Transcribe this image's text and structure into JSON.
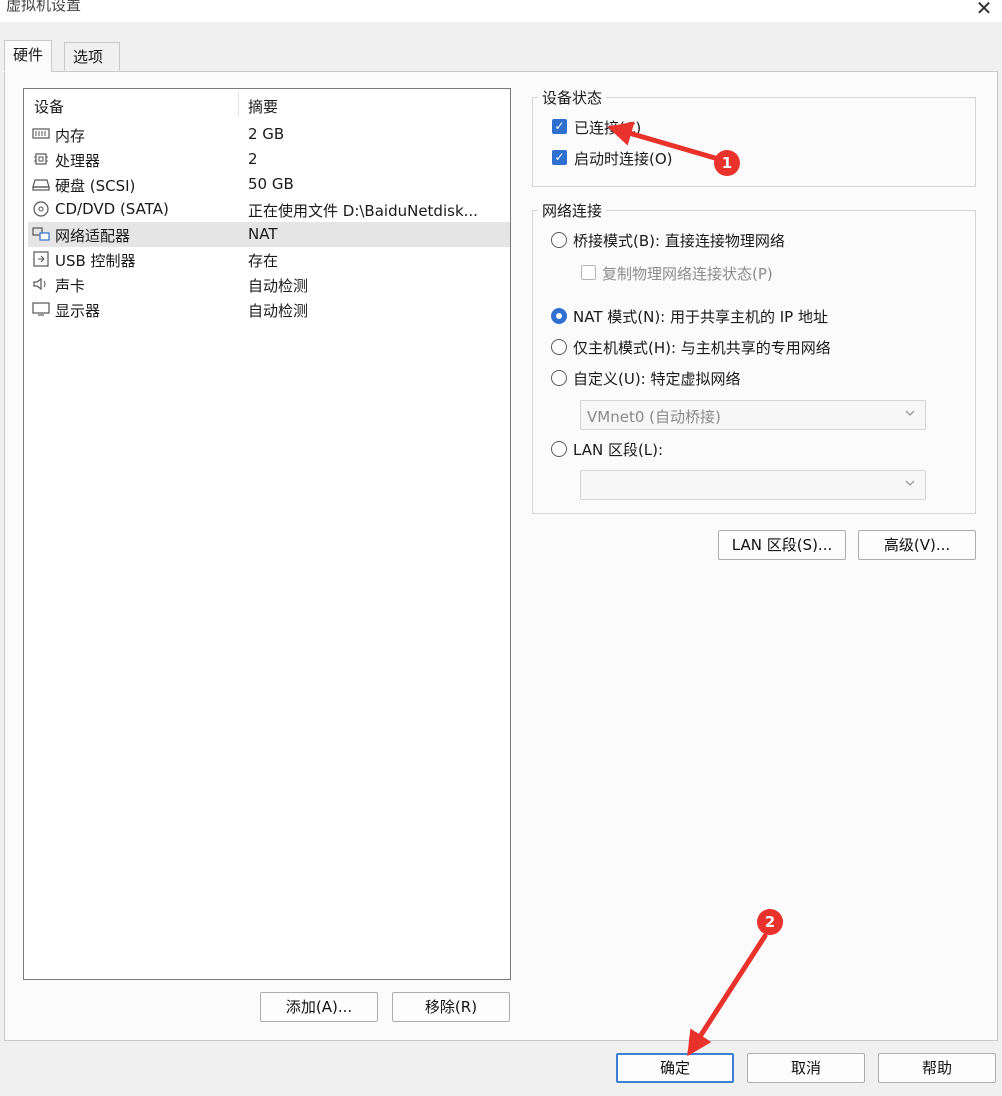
{
  "window": {
    "title": "虚拟机设置",
    "close_glyph": "✕"
  },
  "tabs": [
    {
      "label": "硬件",
      "active": true
    },
    {
      "label": "选项",
      "active": false
    }
  ],
  "device_list": {
    "columns": [
      "设备",
      "摘要"
    ],
    "rows": [
      {
        "icon": "memory-icon",
        "name": "内存",
        "summary": "2 GB"
      },
      {
        "icon": "processor-icon",
        "name": "处理器",
        "summary": "2"
      },
      {
        "icon": "hard-disk-icon",
        "name": "硬盘 (SCSI)",
        "summary": "50 GB"
      },
      {
        "icon": "cd-dvd-icon",
        "name": "CD/DVD (SATA)",
        "summary": "正在使用文件 D:\\BaiduNetdisk..."
      },
      {
        "icon": "network-adapter-icon",
        "name": "网络适配器",
        "summary": "NAT",
        "selected": true
      },
      {
        "icon": "usb-controller-icon",
        "name": "USB 控制器",
        "summary": "存在"
      },
      {
        "icon": "sound-card-icon",
        "name": "声卡",
        "summary": "自动检测"
      },
      {
        "icon": "display-icon",
        "name": "显示器",
        "summary": "自动检测"
      }
    ],
    "add_label": "添加(A)...",
    "remove_label": "移除(R)"
  },
  "device_status": {
    "title": "设备状态",
    "connected": {
      "label": "已连接(C)",
      "checked": true
    },
    "connect_on_power_on": {
      "label": "启动时连接(O)",
      "checked": true
    }
  },
  "network_connection": {
    "title": "网络连接",
    "bridged": {
      "label": "桥接模式(B): 直接连接物理网络",
      "selected": false
    },
    "replicate": {
      "label": "复制物理网络连接状态(P)",
      "checked": false
    },
    "nat": {
      "label": "NAT 模式(N): 用于共享主机的 IP 地址",
      "selected": true
    },
    "host_only": {
      "label": "仅主机模式(H): 与主机共享的专用网络",
      "selected": false
    },
    "custom": {
      "label": "自定义(U): 特定虚拟网络",
      "selected": false
    },
    "custom_select_value": "VMnet0 (自动桥接)",
    "lan_segment": {
      "label": "LAN 区段(L):",
      "selected": false
    },
    "lan_select_value": ""
  },
  "side_buttons": {
    "lan_segments_label": "LAN 区段(S)...",
    "advanced_label": "高级(V)..."
  },
  "footer": {
    "ok_label": "确定",
    "cancel_label": "取消",
    "help_label": "帮助"
  },
  "annotations": {
    "badge_1": "1",
    "badge_2": "2"
  },
  "colors": {
    "accent": "#2f6fd0",
    "annotation": "#e8322b"
  }
}
